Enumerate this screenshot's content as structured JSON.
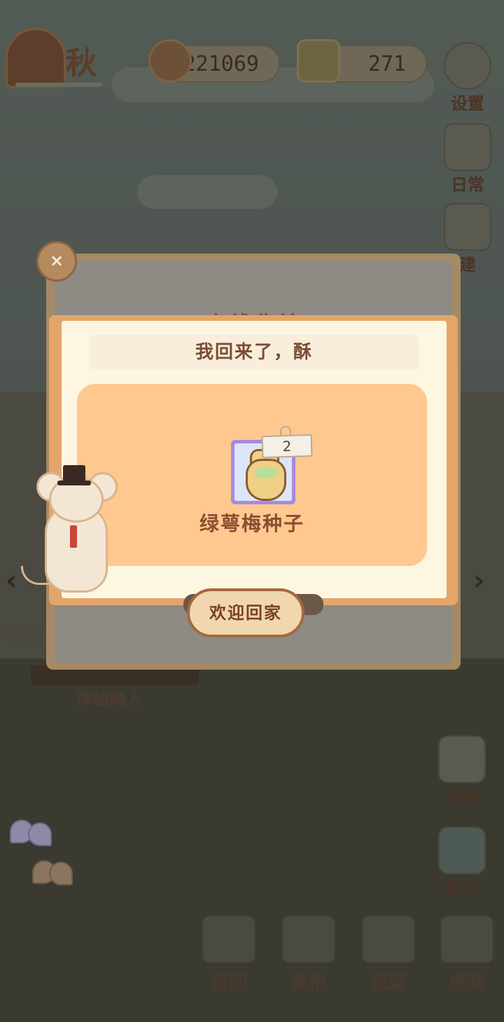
{
  "hud": {
    "season": "秋",
    "fish_count": "221069",
    "cheese_count": "271"
  },
  "side_menu": {
    "settings": "设置",
    "daily": "日常",
    "build": "建",
    "mainline": "主线",
    "travel": "旅行"
  },
  "scene": {
    "merchant_label": "神秘商人",
    "sign_text": "嘻呀你"
  },
  "back_dialog": {
    "title": "离线收益",
    "close_symbol": "×"
  },
  "popup": {
    "title": "我回来了，酥",
    "reward": {
      "name": "绿萼梅种子",
      "quantity": "2"
    },
    "confirm_button": "欢迎回家"
  },
  "bottom_nav": {
    "back": "返回",
    "market": "集市",
    "basket": "花篮",
    "achievement": "成就"
  },
  "colors": {
    "popup_border": "#e4a56a",
    "reward_panel": "#ffc88f",
    "item_card_rarity": "#a68ae0",
    "button_fill": "#f0d7af",
    "title_text": "#7b4d36"
  },
  "icons": [
    "season-tree-icon",
    "fish-bone-icon",
    "cheese-icon",
    "gear-icon",
    "daily-note-icon",
    "build-icon",
    "mainline-note-icon",
    "dragonfly-icon",
    "door-icon",
    "market-stall-icon",
    "flower-basket-icon",
    "trophy-icon",
    "butterfly-icon",
    "seed-bag-icon",
    "mouse-character"
  ]
}
